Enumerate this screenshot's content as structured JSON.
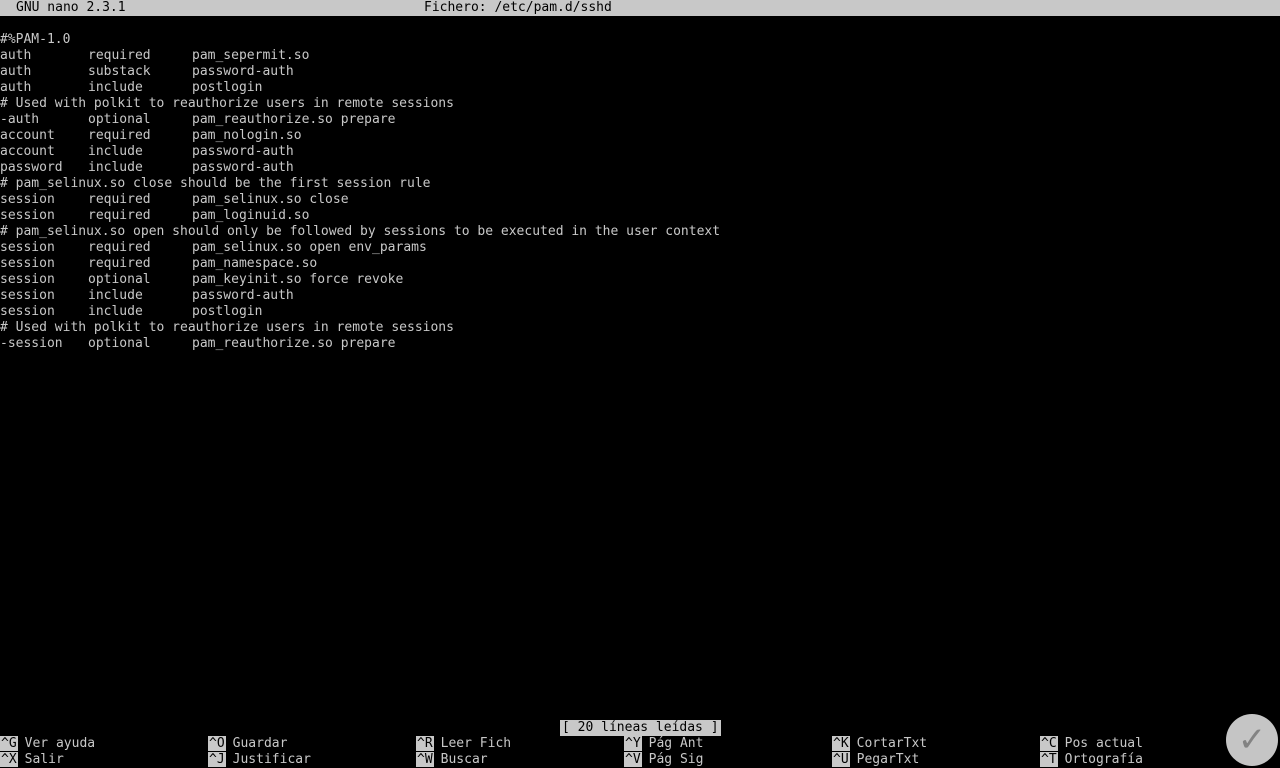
{
  "titlebar": {
    "app": "GNU nano 2.3.1",
    "file": "Fichero: /etc/pam.d/sshd"
  },
  "lines": [
    {
      "comment": "#%PAM-1.0"
    },
    {
      "c1": "auth",
      "c2": "required",
      "c3": "pam_sepermit.so"
    },
    {
      "c1": "auth",
      "c2": "substack",
      "c3": "password-auth"
    },
    {
      "c1": "auth",
      "c2": "include",
      "c3": "postlogin"
    },
    {
      "comment": "# Used with polkit to reauthorize users in remote sessions"
    },
    {
      "c1": "-auth",
      "c2": "optional",
      "c3": "pam_reauthorize.so prepare"
    },
    {
      "c1": "account",
      "c2": "required",
      "c3": "pam_nologin.so"
    },
    {
      "c1": "account",
      "c2": "include",
      "c3": "password-auth"
    },
    {
      "c1": "password",
      "c2": "include",
      "c3": "password-auth"
    },
    {
      "comment": "# pam_selinux.so close should be the first session rule"
    },
    {
      "c1": "session",
      "c2": "required",
      "c3": "pam_selinux.so close"
    },
    {
      "c1": "session",
      "c2": "required",
      "c3": "pam_loginuid.so"
    },
    {
      "comment": "# pam_selinux.so open should only be followed by sessions to be executed in the user context"
    },
    {
      "c1": "session",
      "c2": "required",
      "c3": "pam_selinux.so open env_params"
    },
    {
      "c1": "session",
      "c2": "required",
      "c3": "pam_namespace.so"
    },
    {
      "c1": "session",
      "c2": "optional",
      "c3": "pam_keyinit.so force revoke"
    },
    {
      "c1": "session",
      "c2": "include",
      "c3": "password-auth"
    },
    {
      "c1": "session",
      "c2": "include",
      "c3": "postlogin"
    },
    {
      "comment": "# Used with polkit to reauthorize users in remote sessions"
    },
    {
      "c1": "-session",
      "c2": "optional",
      "c3": "pam_reauthorize.so prepare"
    }
  ],
  "status": "[ 20 líneas leídas ]",
  "shortcuts": {
    "row1": [
      {
        "key": "^G",
        "label": "Ver ayuda"
      },
      {
        "key": "^O",
        "label": "Guardar"
      },
      {
        "key": "^R",
        "label": "Leer Fich"
      },
      {
        "key": "^Y",
        "label": "Pág Ant"
      },
      {
        "key": "^K",
        "label": "CortarTxt"
      },
      {
        "key": "^C",
        "label": "Pos actual"
      }
    ],
    "row2": [
      {
        "key": "^X",
        "label": "Salir"
      },
      {
        "key": "^J",
        "label": "Justificar"
      },
      {
        "key": "^W",
        "label": "Buscar"
      },
      {
        "key": "^V",
        "label": "Pág Sig"
      },
      {
        "key": "^U",
        "label": "PegarTxt"
      },
      {
        "key": "^T",
        "label": "Ortografía"
      }
    ]
  },
  "logo": {
    "icon": "watermark-logo-icon"
  }
}
